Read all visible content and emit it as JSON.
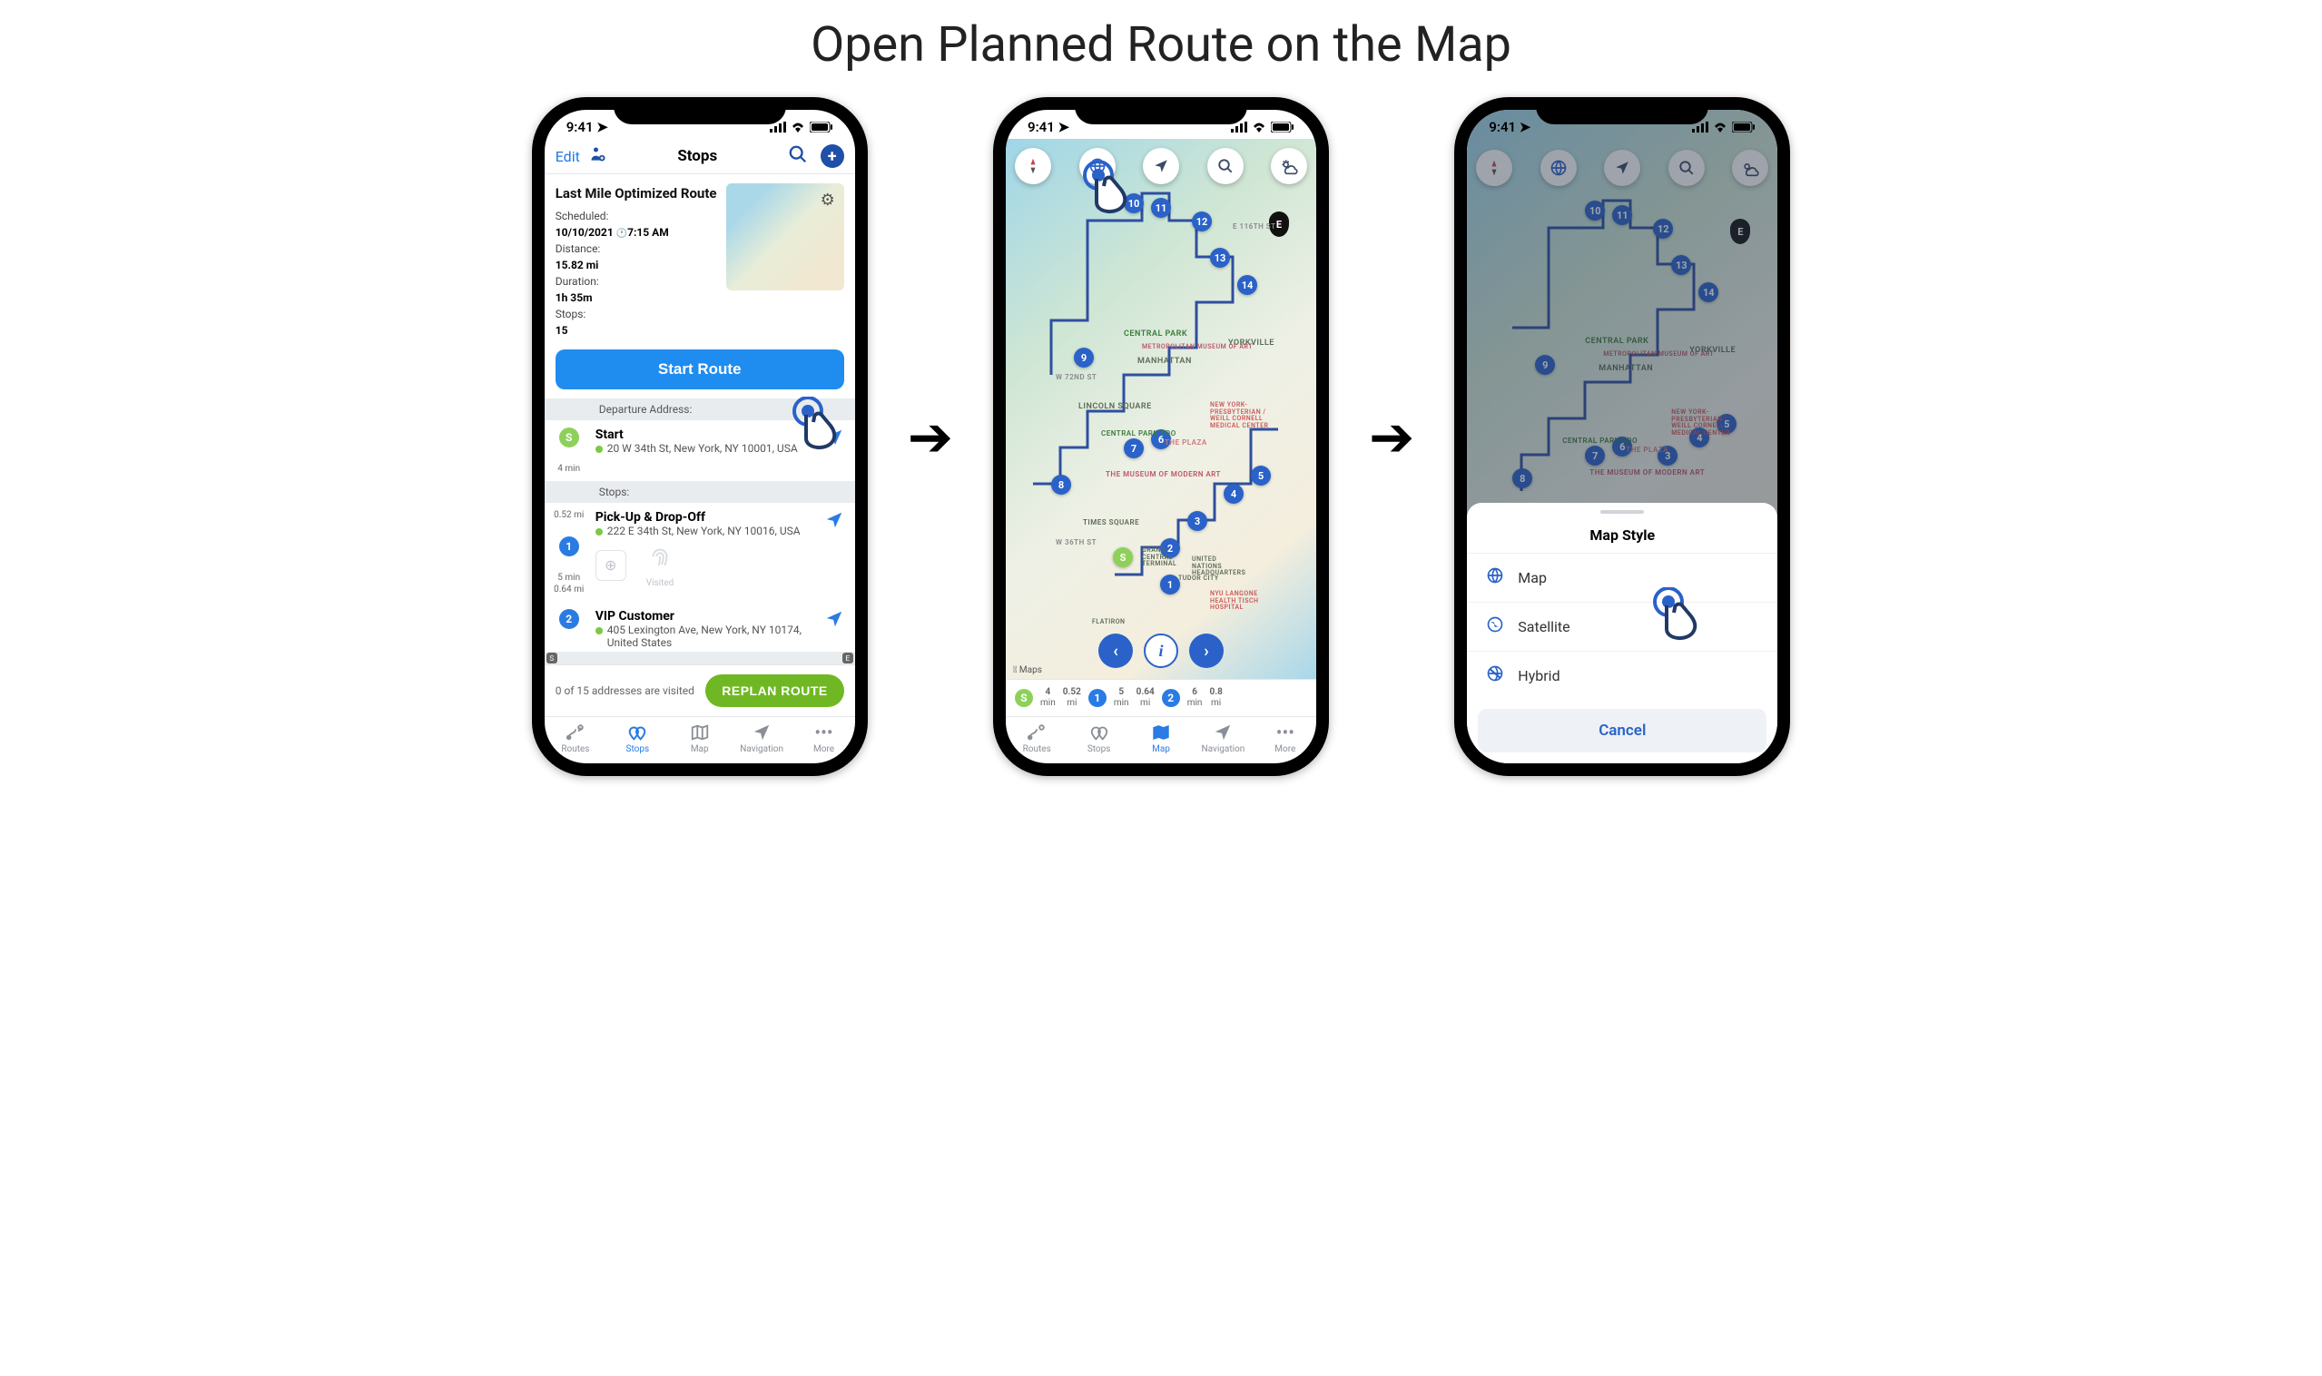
{
  "page_title": "Open Planned Route on the Map",
  "status": {
    "time": "9:41"
  },
  "phone1": {
    "edit": "Edit",
    "title": "Stops",
    "route_name": "Last Mile Optimized Route",
    "scheduled_label": "Scheduled:",
    "scheduled_value": "10/10/2021",
    "scheduled_time": "7:15 AM",
    "distance_label": "Distance:",
    "distance_value": "15.82 mi",
    "duration_label": "Duration:",
    "duration_value": "1h 35m",
    "stops_label": "Stops:",
    "stops_value": "15",
    "start_button": "Start Route",
    "section_departure": "Departure Address:",
    "section_stops": "Stops:",
    "start_node": "S",
    "start_name": "Start",
    "start_addr": "20 W 34th St, New York, NY 10001, USA",
    "t_4min": "4 min",
    "t_052mi": "0.52 mi",
    "stop1_idx": "1",
    "stop1_name": "Pick-Up & Drop-Off",
    "stop1_addr": "222 E 34th St, New York, NY 10016, USA",
    "visited_label": "Visited",
    "t_5min": "5 min",
    "t_064mi": "0.64 mi",
    "stop2_idx": "2",
    "stop2_name": "VIP Customer",
    "stop2_addr": "405 Lexington Ave, New York, NY 10174, United States",
    "visited_status": "0 of 15 addresses are visited",
    "replan": "REPLAN ROUTE",
    "chip_s": "S",
    "chip_e": "E",
    "tabs": {
      "routes": "Routes",
      "stops": "Stops",
      "map": "Map",
      "navigation": "Navigation",
      "more": "More"
    }
  },
  "phone2": {
    "map_labels": {
      "central_park": "Central Park",
      "manhattan": "MANHATTAN",
      "yorkville": "YORKVILLE",
      "lincoln_sq": "LINCOLN SQUARE",
      "cpzoo": "Central Park Zoo",
      "plaza": "The Plaza",
      "moma": "The Museum of Modern Art",
      "times_sq": "TIMES SQUARE",
      "w36": "W 36th St",
      "met": "Metropolitan Museum of Art",
      "presby": "New York-Presbyterian / Weill Cornell Medical Center",
      "w72": "W 72nd St",
      "e116": "E 116th St",
      "gct": "GRAND CENTRAL TERMINAL",
      "un": "UNITED NATIONS HEADQUARTERS",
      "tudor": "TUDOR CITY",
      "langone": "NYU Langone Health Tisch Hospital",
      "flatiron": "FLATIRON"
    },
    "end_pin": "E",
    "credits": " Maps",
    "timeline": {
      "s": "S",
      "t4": "4",
      "min": "min",
      "d052": "0.52",
      "mi": "mi",
      "n1": "1",
      "t5": "5",
      "d064": "0.64",
      "n2": "2",
      "t6": "6",
      "d08": "0.8"
    }
  },
  "phone3": {
    "sheet_title": "Map Style",
    "opt_map": "Map",
    "opt_sat": "Satellite",
    "opt_hyb": "Hybrid",
    "cancel": "Cancel"
  }
}
